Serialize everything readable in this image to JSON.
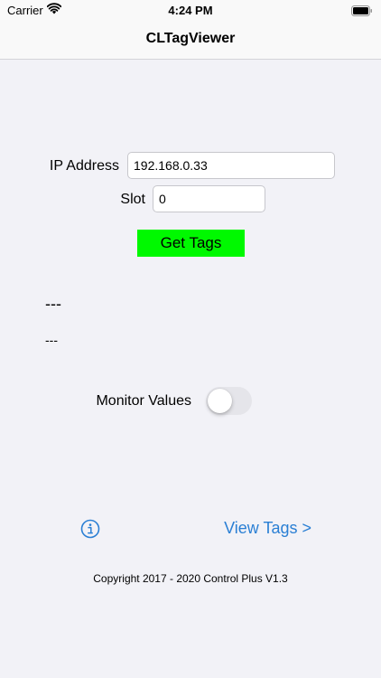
{
  "status_bar": {
    "carrier": "Carrier",
    "time": "4:24 PM"
  },
  "nav": {
    "title": "CLTagViewer"
  },
  "form": {
    "ip_label": "IP Address",
    "ip_value": "192.168.0.33",
    "slot_label": "Slot",
    "slot_value": "0",
    "get_tags_label": "Get Tags"
  },
  "output": {
    "primary": "---",
    "secondary": "---"
  },
  "monitor": {
    "label": "Monitor Values",
    "enabled": false
  },
  "footer": {
    "view_tags_label": "View Tags >",
    "copyright": "Copyright 2017 - 2020 Control Plus V1.3"
  },
  "colors": {
    "background": "#f2f2f7",
    "get_tags_button": "#00f900",
    "link": "#2a7fd4",
    "toggle_off": "#e5e5ea"
  },
  "icons": {
    "wifi": "wifi-icon",
    "battery": "battery-icon",
    "info": "info-icon"
  }
}
